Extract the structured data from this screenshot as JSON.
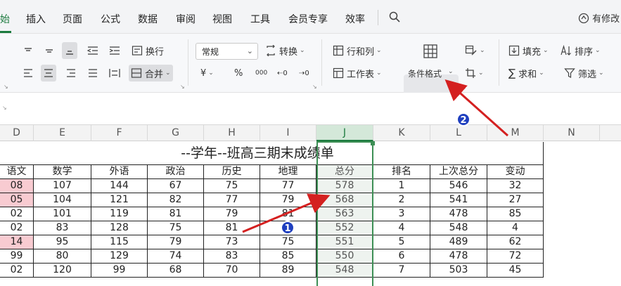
{
  "menu": {
    "first_partial": "始",
    "items": [
      "插入",
      "页面",
      "公式",
      "数据",
      "审阅",
      "视图",
      "工具",
      "会员专享",
      "效率"
    ],
    "modify": "有修改"
  },
  "ribbon": {
    "wrap": "换行",
    "merge": "合并",
    "number_format": "常规",
    "convert": "转换",
    "row_col": "行和列",
    "worksheet": "工作表",
    "conditional_format": "条件格式",
    "fill": "填充",
    "sort": "排序",
    "sum": "求和",
    "filter": "筛选",
    "currency_symbol": "¥",
    "percent_symbol": "%",
    "thousands_symbol": "000"
  },
  "columns": [
    "D",
    "E",
    "F",
    "G",
    "H",
    "I",
    "J",
    "K",
    "L",
    "M",
    "N"
  ],
  "selected_column": "J",
  "table": {
    "title": "--学年--班高三期末成绩单",
    "headers": [
      "语文",
      "数学",
      "外语",
      "政治",
      "历史",
      "地理",
      "总分",
      "排名",
      "上次总分",
      "变动"
    ],
    "rows": [
      [
        "08",
        "107",
        "144",
        "67",
        "75",
        "77",
        "578",
        "1",
        "546",
        "32"
      ],
      [
        "05",
        "104",
        "121",
        "82",
        "77",
        "79",
        "568",
        "2",
        "541",
        "27"
      ],
      [
        "02",
        "101",
        "119",
        "81",
        "79",
        "81",
        "563",
        "3",
        "478",
        "85"
      ],
      [
        "02",
        "83",
        "128",
        "75",
        "81",
        "",
        "552",
        "4",
        "548",
        "4"
      ],
      [
        "14",
        "95",
        "115",
        "79",
        "73",
        "75",
        "551",
        "5",
        "489",
        "62"
      ],
      [
        "99",
        "80",
        "129",
        "74",
        "83",
        "85",
        "550",
        "6",
        "478",
        "72"
      ],
      [
        "02",
        "120",
        "99",
        "68",
        "70",
        "89",
        "548",
        "7",
        "503",
        "45"
      ]
    ],
    "highlighted_rows": [
      0,
      1,
      4
    ]
  },
  "annotations": [
    {
      "label": "1"
    },
    {
      "label": "2"
    }
  ],
  "colors": {
    "accent": "#1b7a3e",
    "highlight_pink": "#f8cbd1",
    "arrow_red": "#d42020",
    "badge_blue": "#1f3fbf"
  }
}
